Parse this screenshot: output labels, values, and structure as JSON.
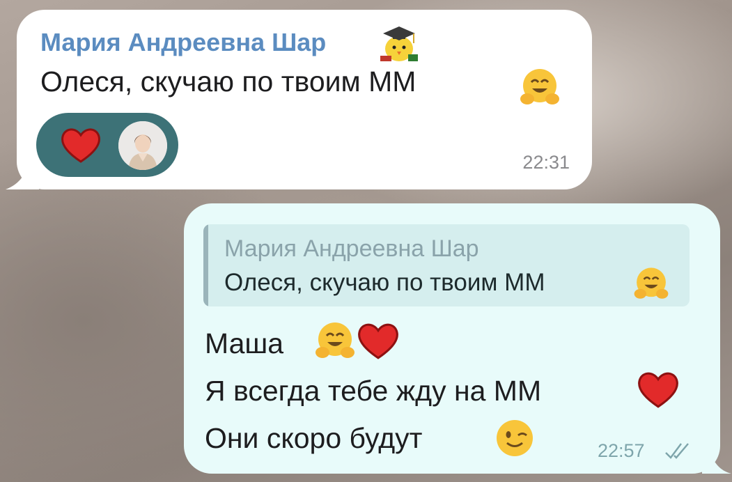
{
  "incoming": {
    "sender": "Мария Андреевна Шар",
    "sender_badge_icon": "graduation-chick-emoji",
    "text": "Олеся, скучаю по твоим ММ",
    "text_emoji": "hugging-face",
    "reaction": {
      "emoji": "red-heart",
      "avatar": "user-avatar"
    },
    "time": "22:31"
  },
  "outgoing": {
    "reply": {
      "name": "Мария Андреевна Шар",
      "text": "Олеся, скучаю по твоим ММ",
      "emoji": "hugging-face"
    },
    "lines": [
      "Маша",
      "Я всегда тебе жду на ММ",
      "Они скоро будут"
    ],
    "time": "22:57",
    "status_icon": "double-check"
  },
  "colors": {
    "sender_name": "#5b8cc0",
    "reaction_bg": "#3d7277",
    "outgoing_bg": "#e8fbfa",
    "reply_bg": "#d5eeee"
  }
}
